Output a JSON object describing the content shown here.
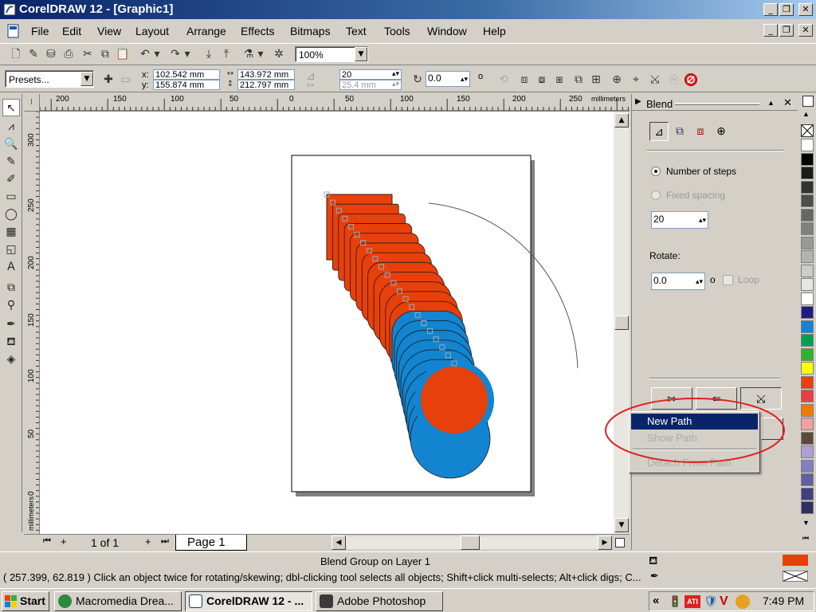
{
  "window": {
    "title": "CorelDRAW 12 - [Graphic1]"
  },
  "menubar": {
    "items": [
      "File",
      "Edit",
      "View",
      "Layout",
      "Arrange",
      "Effects",
      "Bitmaps",
      "Text",
      "Tools",
      "Window",
      "Help"
    ]
  },
  "toolbar": {
    "zoom": "100%"
  },
  "propbar": {
    "presets": "Presets...",
    "x": "102.542 mm",
    "y": "155.874 mm",
    "width": "143.972 mm",
    "height": "212.797 mm",
    "steps": "20",
    "spacing": "25.4 mm",
    "rotate": "0.0",
    "degree": "o",
    "x_label": "x:",
    "y_label": "y:"
  },
  "ruler": {
    "h_ticks": [
      "200",
      "150",
      "100",
      "50",
      "0",
      "50",
      "100",
      "150",
      "200",
      "250"
    ],
    "h_unit": "millimeters",
    "v_ticks": [
      "300",
      "250",
      "200",
      "150",
      "100",
      "50",
      "0"
    ],
    "v_unit": "millimeters"
  },
  "pager": {
    "of": "1 of 1",
    "tab": "Page 1"
  },
  "docker": {
    "title": "Blend",
    "number_of_steps": "Number of steps",
    "fixed_spacing": "Fixed spacing",
    "steps_value": "20",
    "rotate_label": "Rotate:",
    "rotate_value": "0.0",
    "degree": "o",
    "loop": "Loop"
  },
  "context_menu": {
    "items": [
      "New Path",
      "Show Path",
      "Detach From Path"
    ]
  },
  "status": {
    "line1": "Blend Group on Layer 1",
    "line2": "( 257.399, 62.819 ) Click an object twice for rotating/skewing; dbl-clicking tool selects all objects; Shift+click multi-selects; Alt+click digs; C..."
  },
  "taskbar": {
    "start": "Start",
    "tasks": [
      "Macromedia Drea...",
      "CorelDRAW 12 - ...",
      "Adobe Photoshop"
    ],
    "clock": "7:49 PM",
    "tray_chevron": "«"
  },
  "colors": {
    "orange": "#e8400a",
    "blue": "#1284d0",
    "annotation": "#e02020",
    "selection": "#0a246a"
  },
  "palette": [
    "#ffffff",
    "#000000",
    "#1a1a1a",
    "#333333",
    "#4d4d4d",
    "#666666",
    "#808080",
    "#999999",
    "#b3b3b3",
    "#cccccc",
    "#e6e6e6",
    "#ffffff",
    "#1e1e7a",
    "#1284d0",
    "#00a050",
    "#2bb52b",
    "#ffff00",
    "#e8400a",
    "#e84040",
    "#f07a00",
    "#f0a0a0",
    "#5a4a3a",
    "#b0a0d0",
    "#8080c0",
    "#6060a0",
    "#404080",
    "#303060"
  ]
}
